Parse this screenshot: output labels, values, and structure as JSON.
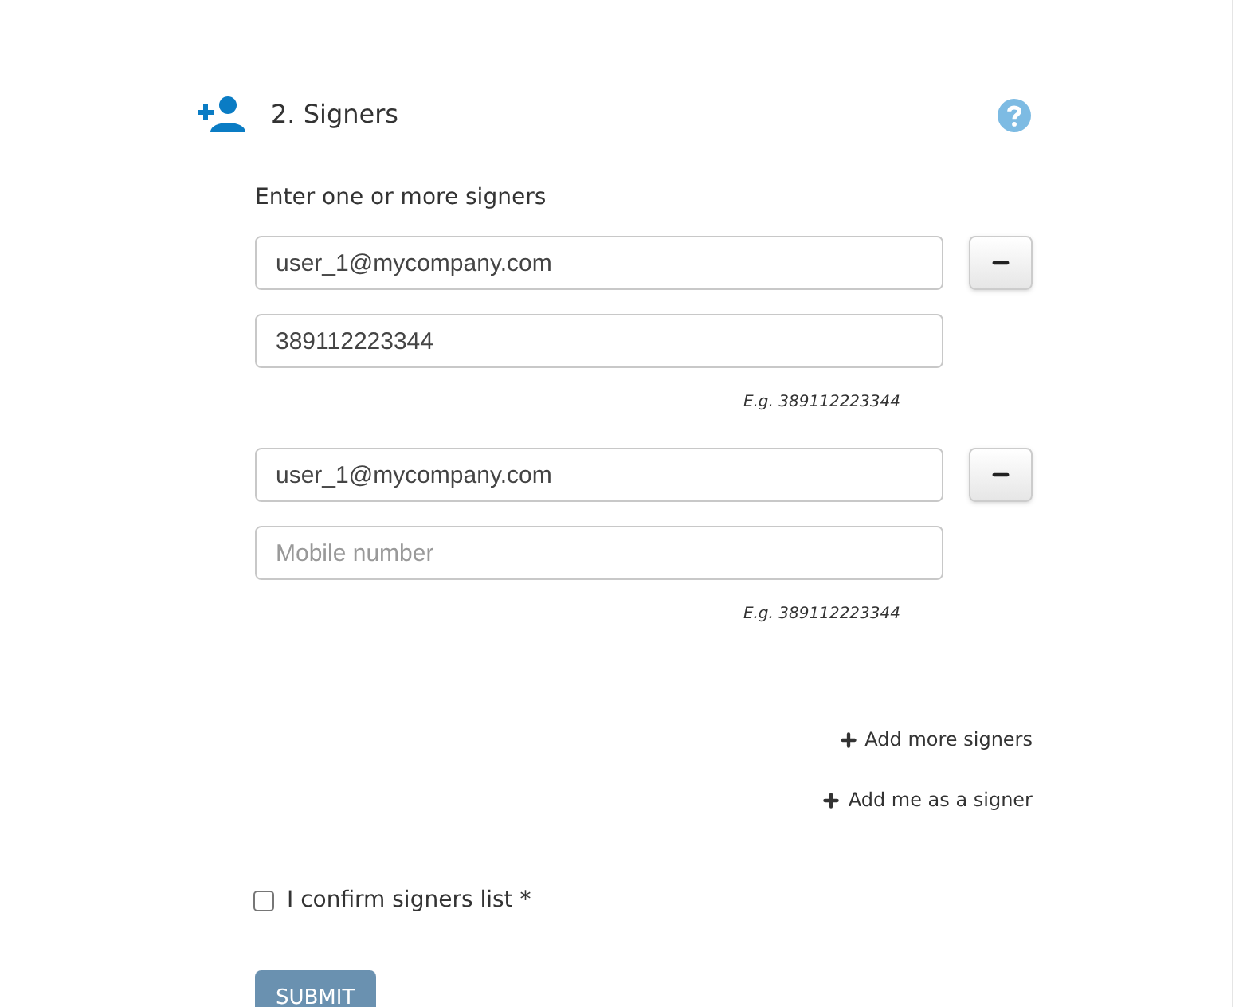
{
  "section": {
    "title": "2. Signers"
  },
  "prompt": "Enter one or more signers",
  "signers": [
    {
      "email": {
        "value": "user_1@mycompany.com"
      },
      "mobile": {
        "value": "389112223344"
      },
      "hint": "E.g. 389112223344"
    },
    {
      "email": {
        "value": "user_1@mycompany.com"
      },
      "mobile": {
        "placeholder": "Mobile number"
      },
      "hint": "E.g. 389112223344"
    }
  ],
  "links": [
    "Add more signers",
    "Add me as a signer"
  ],
  "confirm": {
    "label": "I confirm signers list *",
    "checked": false
  },
  "submit": "SUBMIT"
}
